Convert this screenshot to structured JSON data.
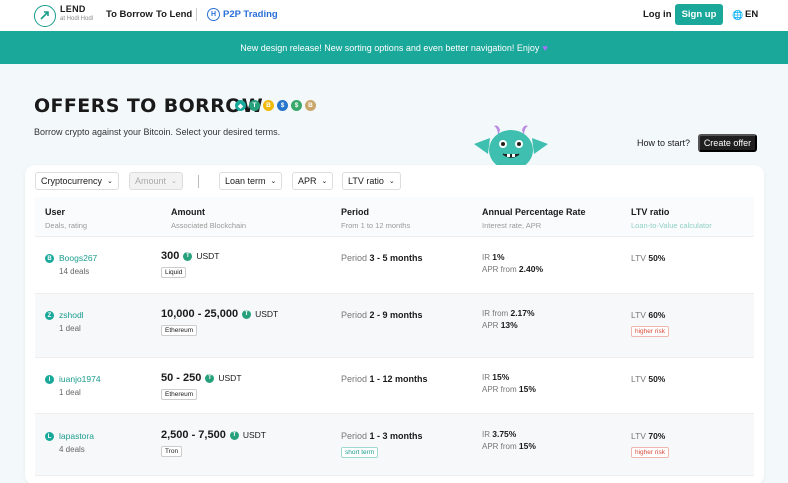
{
  "header": {
    "logo_text": "LEND",
    "logo_sub": "at Hodl Hodl",
    "nav_borrow": "To Borrow",
    "nav_lend": "To Lend",
    "nav_p2p": "P2P Trading",
    "login": "Log in",
    "signup": "Sign up",
    "language": "EN"
  },
  "banner": {
    "text": "New design release! New sorting options and even better navigation! Enjoy"
  },
  "page": {
    "title": "OFFERS TO BORROW",
    "subtitle": "Borrow crypto against your Bitcoin. Select your desired terms.",
    "how_to_start": "How to start?",
    "create_offer": "Create offer",
    "coins": [
      {
        "symbol": "◆",
        "color": "#1aa89a"
      },
      {
        "symbol": "T",
        "color": "#26a17b"
      },
      {
        "symbol": "B",
        "color": "#f0b90b"
      },
      {
        "symbol": "$",
        "color": "#2775ca"
      },
      {
        "symbol": "$",
        "color": "#3aa86b"
      },
      {
        "symbol": "B",
        "color": "#c9a66b"
      }
    ]
  },
  "filters": {
    "cryptocurrency": "Cryptocurrency",
    "amount": "Amount",
    "loan_term": "Loan term",
    "apr": "APR",
    "ltv_ratio": "LTV ratio"
  },
  "table": {
    "headers": {
      "user": "User",
      "user_sub": "Deals, rating",
      "amount": "Amount",
      "amount_sub": "Associated Blockchain",
      "period": "Period",
      "period_sub": "From 1 to 12 months",
      "apr": "Annual Percentage Rate",
      "apr_sub": "Interest rate, APR",
      "ltv": "LTV ratio",
      "ltv_sub": "Loan-to-Value calculator"
    },
    "rows": [
      {
        "initial": "B",
        "user": "Boogs267",
        "deals": "14 deals",
        "amount": "300",
        "currency": "USDT",
        "chain": "Liquid",
        "period_label": "Period",
        "period": "3 - 5 months",
        "period_tag": "",
        "ir_label": "IR",
        "ir": "1%",
        "apr_label": "APR from",
        "apr": "2.40%",
        "ltv_label": "LTV",
        "ltv": "50%",
        "ltv_tag": ""
      },
      {
        "initial": "Z",
        "user": "zshodl",
        "deals": "1 deal",
        "amount": "10,000 - 25,000",
        "currency": "USDT",
        "chain": "Ethereum",
        "period_label": "Period",
        "period": "2 - 9 months",
        "period_tag": "",
        "ir_label": "IR from",
        "ir": "2.17%",
        "apr_label": "APR",
        "apr": "13%",
        "ltv_label": "LTV",
        "ltv": "60%",
        "ltv_tag": "higher risk"
      },
      {
        "initial": "I",
        "user": "iuanjo1974",
        "deals": "1 deal",
        "amount": "50 - 250",
        "currency": "USDT",
        "chain": "Ethereum",
        "period_label": "Period",
        "period": "1 - 12 months",
        "period_tag": "",
        "ir_label": "IR",
        "ir": "15%",
        "apr_label": "APR from",
        "apr": "15%",
        "ltv_label": "LTV",
        "ltv": "50%",
        "ltv_tag": ""
      },
      {
        "initial": "L",
        "user": "lapastora",
        "deals": "4 deals",
        "amount": "2,500 - 7,500",
        "currency": "USDT",
        "chain": "Tron",
        "period_label": "Period",
        "period": "1 - 3 months",
        "period_tag": "short term",
        "ir_label": "IR",
        "ir": "3.75%",
        "apr_label": "APR from",
        "apr": "15%",
        "ltv_label": "LTV",
        "ltv": "70%",
        "ltv_tag": "higher risk"
      }
    ]
  }
}
